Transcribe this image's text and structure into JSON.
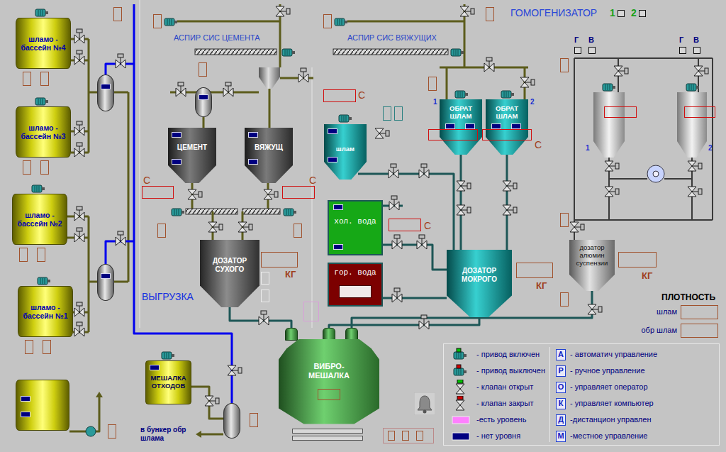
{
  "header": {
    "title": "ГОМОГЕНИЗАТОР",
    "modes": [
      {
        "label": "1"
      },
      {
        "label": "2"
      }
    ]
  },
  "pools": [
    {
      "label": "шламо - бассейн №4"
    },
    {
      "label": "шламо - бассейн №3"
    },
    {
      "label": "шламо - бассейн №2"
    },
    {
      "label": "шламо - бассейн №1"
    }
  ],
  "storage_tank": {
    "has_level": false
  },
  "receivers": [
    {
      "has_level": false
    },
    {
      "has_level": false
    }
  ],
  "feed_vessel": {
    "has_level": false
  },
  "aspiration": [
    {
      "label": "АСПИР СИС ЦЕМЕНТА"
    },
    {
      "label": "АСПИР СИС ВЯЖУЩИХ"
    }
  ],
  "silos": [
    {
      "label": "ЦЕМЕНТ",
      "unit": "С",
      "has_level": false
    },
    {
      "label": "ВЯЖУЩ",
      "unit": "С",
      "has_level": false
    }
  ],
  "slurry_tank": {
    "label": "шлам",
    "unit": "С",
    "has_level": false
  },
  "return_tanks": [
    {
      "number": "1",
      "label": "ОБРАТ ШЛАМ",
      "has_level": false
    },
    {
      "number": "2",
      "label": "ОБРАТ ШЛАМ",
      "has_level": false
    }
  ],
  "return_unit": "С",
  "cold_water": {
    "label": "хол. вода",
    "unit": "С",
    "has_level": false
  },
  "hot_water": {
    "label": "гор. вода"
  },
  "dry_doser": {
    "label": "ДОЗАТОР СУХОГО",
    "unit": "КГ"
  },
  "wet_doser": {
    "label": "ДОЗАТОР МОКРОГО",
    "unit": "КГ"
  },
  "al_doser": {
    "label": "дозатор алюмин суспензии",
    "unit": "КГ"
  },
  "homogenizers": [
    {
      "number": "1",
      "flags": [
        "Г",
        "В"
      ]
    },
    {
      "number": "2",
      "flags": [
        "Г",
        "В"
      ]
    }
  ],
  "density": {
    "title": "ПЛОТНОСТЬ",
    "rows": [
      {
        "label": "шлам"
      },
      {
        "label": "обр шлам"
      }
    ]
  },
  "unload": "ВЫГРУЗКА",
  "vibro_mixer": {
    "label": "ВИБРО- МЕШАЛКА"
  },
  "waste_mixer": {
    "label": "МЕШАЛКА ОТХОДОВ",
    "has_level": false
  },
  "to_bunker": "в бункер обр шлама",
  "legend": {
    "symbols": [
      {
        "kind": "drive-on",
        "text": "- привод включен"
      },
      {
        "kind": "drive-off",
        "text": "- привод выключен"
      },
      {
        "kind": "valve-open",
        "text": "- клапан открыт"
      },
      {
        "kind": "valve-closed",
        "text": "- клапан закрыт"
      },
      {
        "kind": "level-yes",
        "text": "-есть уровень"
      },
      {
        "kind": "level-no",
        "text": "- нет уровня"
      }
    ],
    "modes": [
      {
        "key": "А",
        "text": "- автоматич управление"
      },
      {
        "key": "Р",
        "text": "- ручное управление"
      },
      {
        "key": "О",
        "text": "- управляет оператор"
      },
      {
        "key": "К",
        "text": "- управляет компьютер"
      },
      {
        "key": "Д",
        "text": "-дистанцион управлен"
      },
      {
        "key": "М",
        "text": "-местное управление"
      }
    ]
  }
}
